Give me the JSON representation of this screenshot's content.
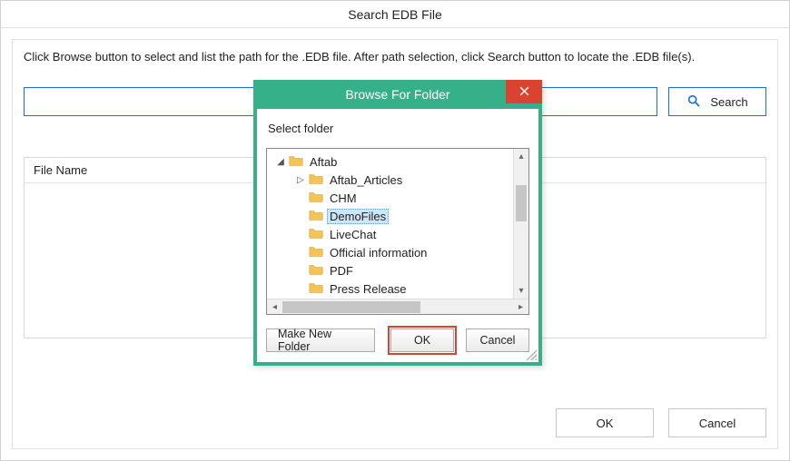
{
  "window": {
    "title": "Search EDB File"
  },
  "instruction": "Click Browse button to select and list the path for the .EDB file. After path selection, click Search button to locate the .EDB file(s).",
  "search": {
    "button": "Search",
    "path_value": ""
  },
  "table": {
    "header": "File Name"
  },
  "buttons": {
    "ok": "OK",
    "cancel": "Cancel"
  },
  "modal": {
    "title": "Browse For Folder",
    "label": "Select folder",
    "make_new_folder": "Make New Folder",
    "ok": "OK",
    "cancel": "Cancel",
    "tree": {
      "root": {
        "name": "Aftab",
        "expanded": true
      },
      "children": [
        {
          "name": "Aftab_Articles",
          "hasChildren": true
        },
        {
          "name": "CHM"
        },
        {
          "name": "DemoFiles",
          "selected": true
        },
        {
          "name": "LiveChat"
        },
        {
          "name": "Official information"
        },
        {
          "name": "PDF"
        },
        {
          "name": "Press Release"
        }
      ]
    }
  }
}
